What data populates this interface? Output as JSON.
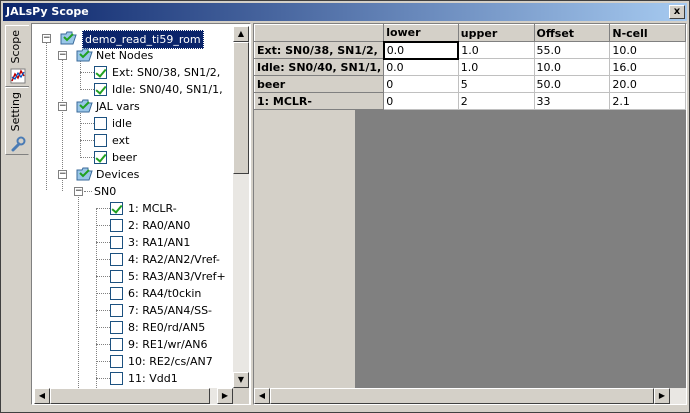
{
  "window": {
    "title": "JALsPy Scope",
    "close_label": "x"
  },
  "side_tabs": [
    {
      "label": "Scope",
      "icon": "chart-icon"
    },
    {
      "label": "Setting",
      "icon": "wrench-icon"
    }
  ],
  "tree": {
    "root": "demo_read_ti59_rom",
    "net_nodes": {
      "label": "Net Nodes",
      "items": [
        {
          "label": "Ext:   SN0/38, SN1/2,",
          "checked": true
        },
        {
          "label": "Idle:   SN0/40, SN1/1,",
          "checked": true
        }
      ]
    },
    "jal_vars": {
      "label": "JAL vars",
      "items": [
        {
          "label": "idle",
          "checked": false
        },
        {
          "label": "ext",
          "checked": false
        },
        {
          "label": "beer",
          "checked": true
        }
      ]
    },
    "devices": {
      "label": "Devices",
      "sn0": {
        "label": "SN0",
        "pins": [
          {
            "label": "1:   MCLR-",
            "checked": true
          },
          {
            "label": "2:   RA0/AN0",
            "checked": false
          },
          {
            "label": "3:   RA1/AN1",
            "checked": false
          },
          {
            "label": "4:   RA2/AN2/Vref-",
            "checked": false
          },
          {
            "label": "5:   RA3/AN3/Vref+",
            "checked": false
          },
          {
            "label": "6:   RA4/t0ckin",
            "checked": false
          },
          {
            "label": "7:   RA5/AN4/SS-",
            "checked": false
          },
          {
            "label": "8:   RE0/rd/AN5",
            "checked": false
          },
          {
            "label": "9:   RE1/wr/AN6",
            "checked": false
          },
          {
            "label": "10:   RE2/cs/AN7",
            "checked": false
          },
          {
            "label": "11:   Vdd1",
            "checked": false
          }
        ]
      }
    }
  },
  "grid": {
    "columns": [
      "lower",
      "upper",
      "Offset",
      "N-cell"
    ],
    "rows": [
      {
        "header": "Ext:  SN0/38, SN1/2,",
        "cells": [
          "0.0",
          "1.0",
          "55.0",
          "10.0"
        ]
      },
      {
        "header": "Idle:  SN0/40, SN1/1,",
        "cells": [
          "0.0",
          "1.0",
          "10.0",
          "16.0"
        ]
      },
      {
        "header": "beer",
        "cells": [
          "0",
          "5",
          "50.0",
          "20.0"
        ]
      },
      {
        "header": "1:   MCLR-",
        "cells": [
          "0",
          "2",
          "33",
          "2.1"
        ]
      }
    ]
  },
  "colors": {
    "title_start": "#0a246a",
    "title_end": "#a6caf0",
    "selection": "#0a246a",
    "check": "#21a121"
  }
}
